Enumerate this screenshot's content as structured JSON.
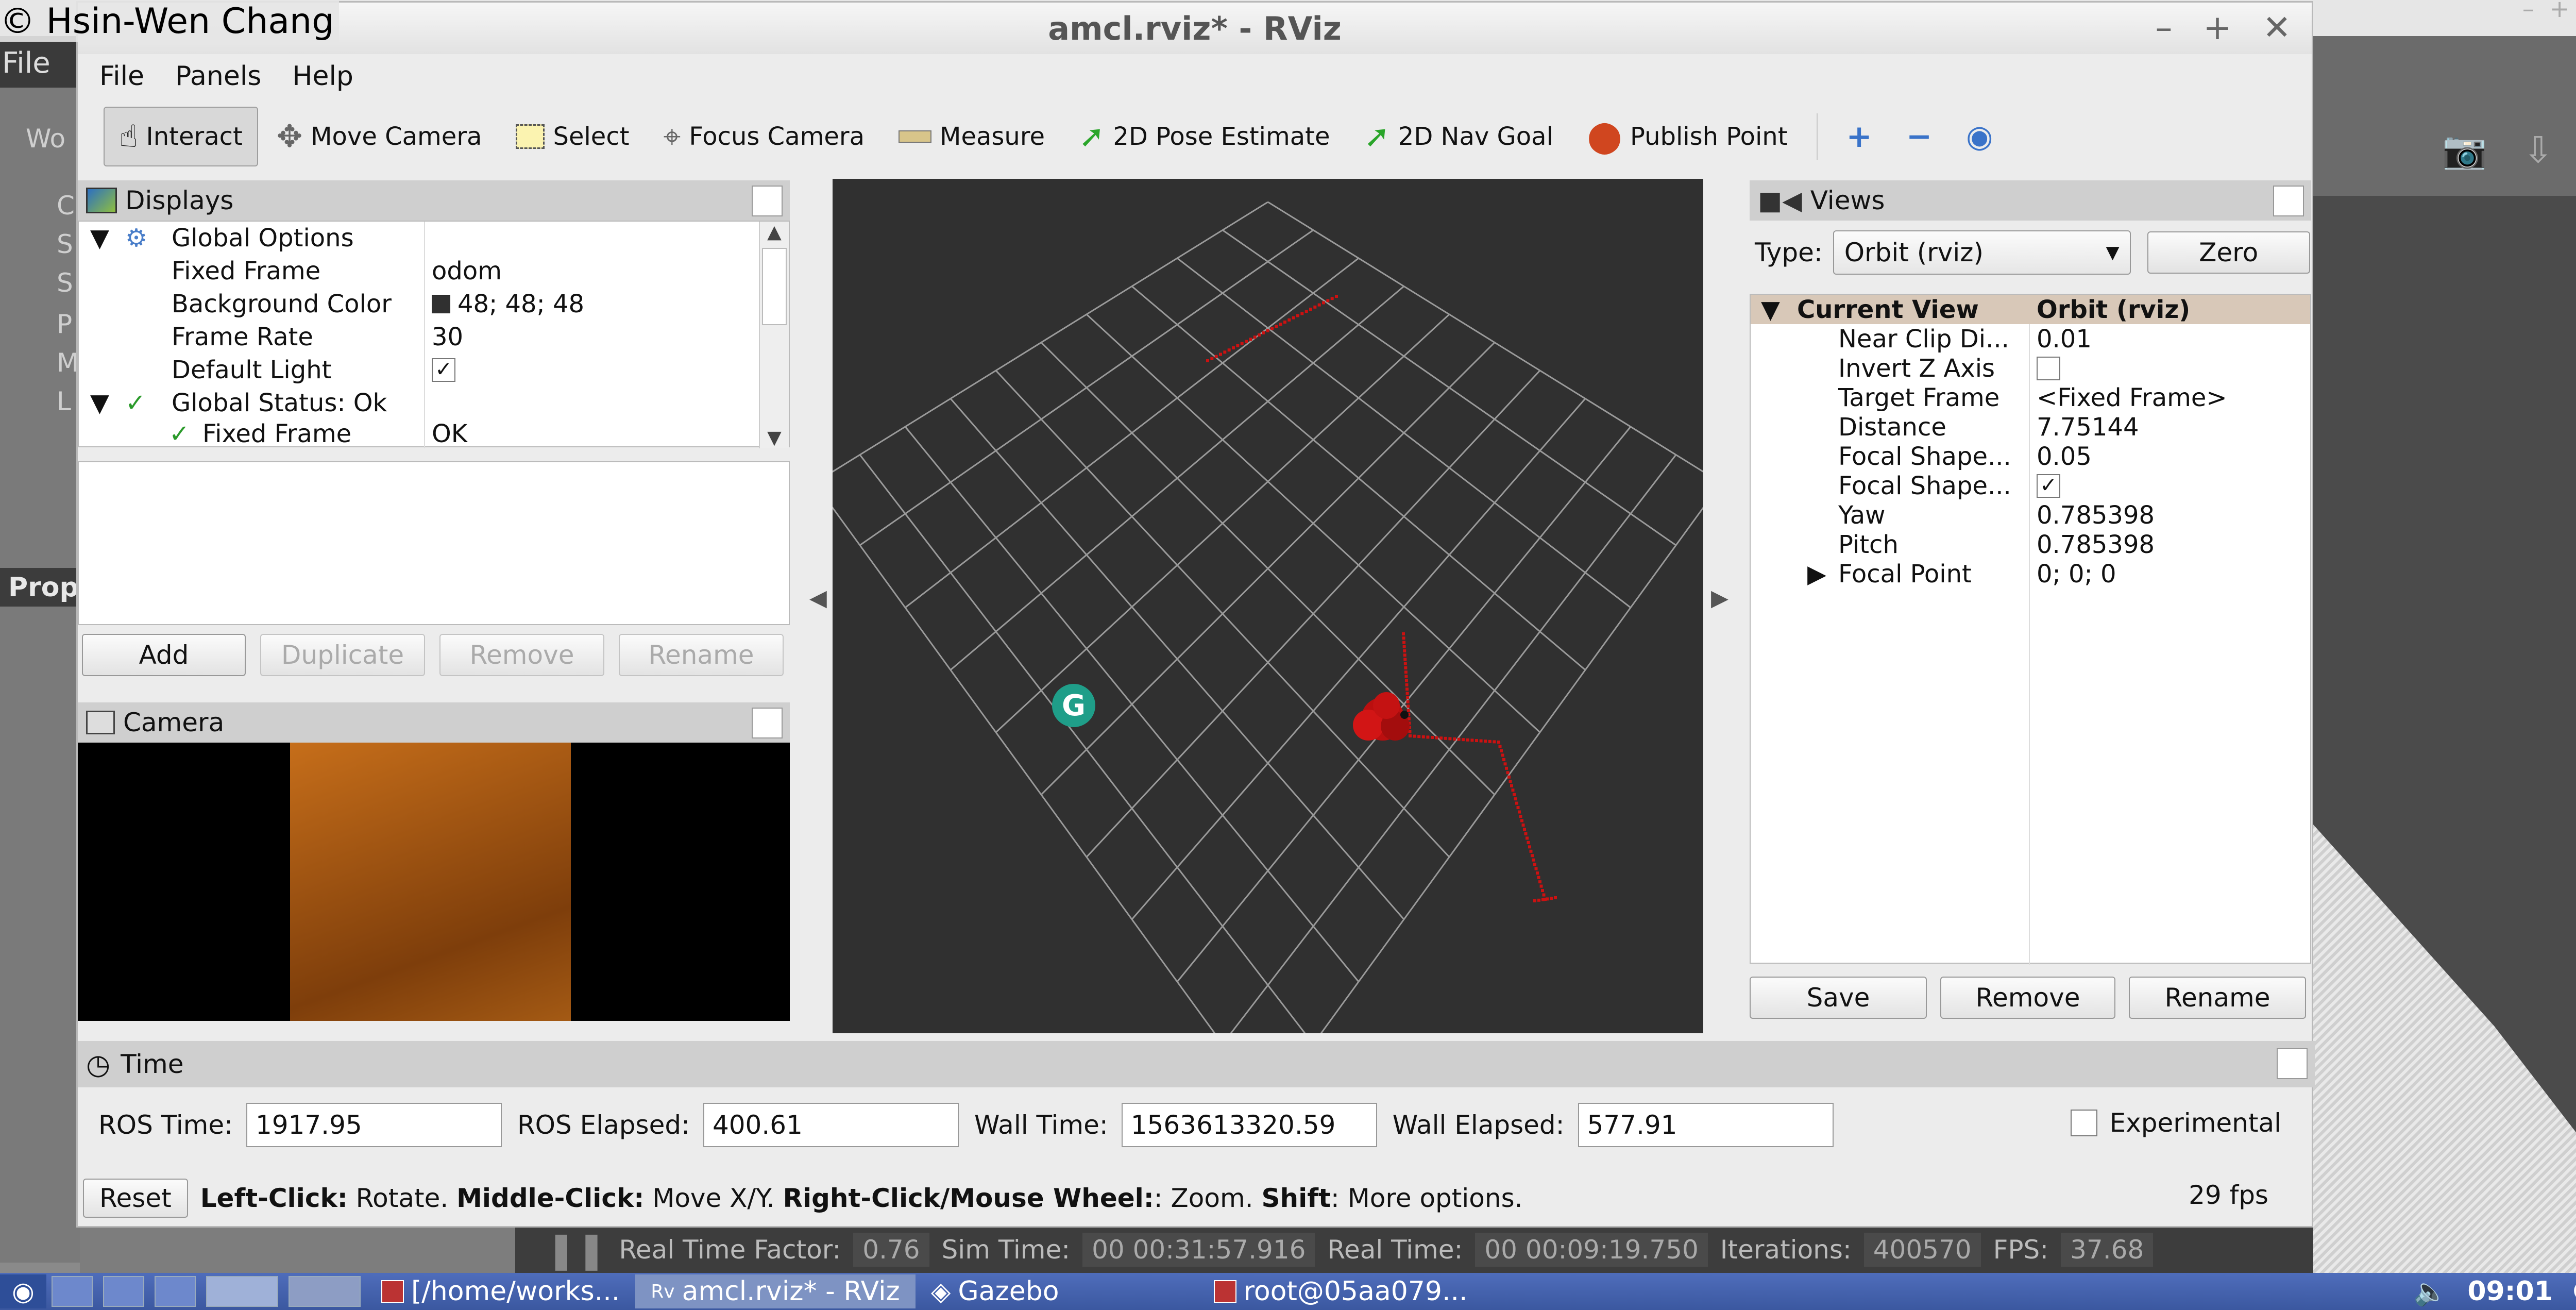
{
  "copyright": "© Hsin-Wen Chang",
  "background": {
    "file_menu": "File",
    "left_texts": [
      "Wo",
      "C",
      "S",
      "S",
      "P",
      "M",
      "L"
    ],
    "properties_label": "Prop",
    "gazebo_bar": {
      "real_time_factor_label": "Real Time Factor:",
      "real_time_factor": "0.76",
      "sim_time_label": "Sim Time:",
      "sim_time": "00 00:31:57.916",
      "real_time_label": "Real Time:",
      "real_time": "00 00:09:19.750",
      "iterations_label": "Iterations:",
      "iterations": "400570",
      "fps_label": "FPS:",
      "fps": "37.68"
    }
  },
  "window": {
    "title": "amcl.rviz* - RViz",
    "menu": {
      "file": "File",
      "panels": "Panels",
      "help": "Help"
    },
    "toolbar": {
      "interact": "Interact",
      "move_camera": "Move Camera",
      "select": "Select",
      "focus_camera": "Focus Camera",
      "measure": "Measure",
      "pose_estimate": "2D Pose Estimate",
      "nav_goal": "2D Nav Goal",
      "publish_point": "Publish Point"
    }
  },
  "displays": {
    "title": "Displays",
    "rows": [
      {
        "name": "Global Options",
        "value": ""
      },
      {
        "name": "Fixed Frame",
        "value": "odom"
      },
      {
        "name": "Background Color",
        "value": "48; 48; 48"
      },
      {
        "name": "Frame Rate",
        "value": "30"
      },
      {
        "name": "Default Light",
        "value": "✓"
      },
      {
        "name": "Global Status: Ok",
        "value": ""
      },
      {
        "name": "Fixed Frame",
        "value": "OK"
      }
    ],
    "buttons": {
      "add": "Add",
      "duplicate": "Duplicate",
      "remove": "Remove",
      "rename": "Rename"
    }
  },
  "camera": {
    "title": "Camera"
  },
  "views": {
    "title": "Views",
    "type_label": "Type:",
    "type_value": "Orbit (rviz)",
    "zero": "Zero",
    "rows": [
      {
        "name": "Current View",
        "value": "Orbit (rviz)"
      },
      {
        "name": "Near Clip Di...",
        "value": "0.01"
      },
      {
        "name": "Invert Z Axis",
        "value": ""
      },
      {
        "name": "Target Frame",
        "value": "<Fixed Frame>"
      },
      {
        "name": "Distance",
        "value": "7.75144"
      },
      {
        "name": "Focal Shape...",
        "value": "0.05"
      },
      {
        "name": "Focal Shape...",
        "value": "✓"
      },
      {
        "name": "Yaw",
        "value": "0.785398"
      },
      {
        "name": "Pitch",
        "value": "0.785398"
      },
      {
        "name": "Focal Point",
        "value": "0; 0; 0"
      }
    ],
    "buttons": {
      "save": "Save",
      "remove": "Remove",
      "rename": "Rename"
    }
  },
  "time": {
    "title": "Time",
    "ros_time_label": "ROS Time:",
    "ros_time": "1917.95",
    "ros_elapsed_label": "ROS Elapsed:",
    "ros_elapsed": "400.61",
    "wall_time_label": "Wall Time:",
    "wall_time": "1563613320.59",
    "wall_elapsed_label": "Wall Elapsed:",
    "wall_elapsed": "577.91",
    "experimental": "Experimental"
  },
  "status": {
    "reset": "Reset",
    "left_click": "Left-Click:",
    "rotate": "Rotate.",
    "middle_click": "Middle-Click:",
    "move": "Move X/Y.",
    "right_click": "Right-Click/Mouse Wheel:",
    "zoom": ": Zoom.",
    "shift": "Shift",
    "more": ": More options.",
    "fps": "29 fps"
  },
  "taskbar": {
    "tasks": [
      "[/home/works...",
      "amcl.rviz* - RViz",
      "Gazebo",
      "root@05aa079..."
    ],
    "clock": "09:01"
  },
  "colors": {
    "laser": "#cc1111",
    "grid": "#a0a0a0",
    "background": "#303030",
    "marker": "#1f9e89"
  }
}
